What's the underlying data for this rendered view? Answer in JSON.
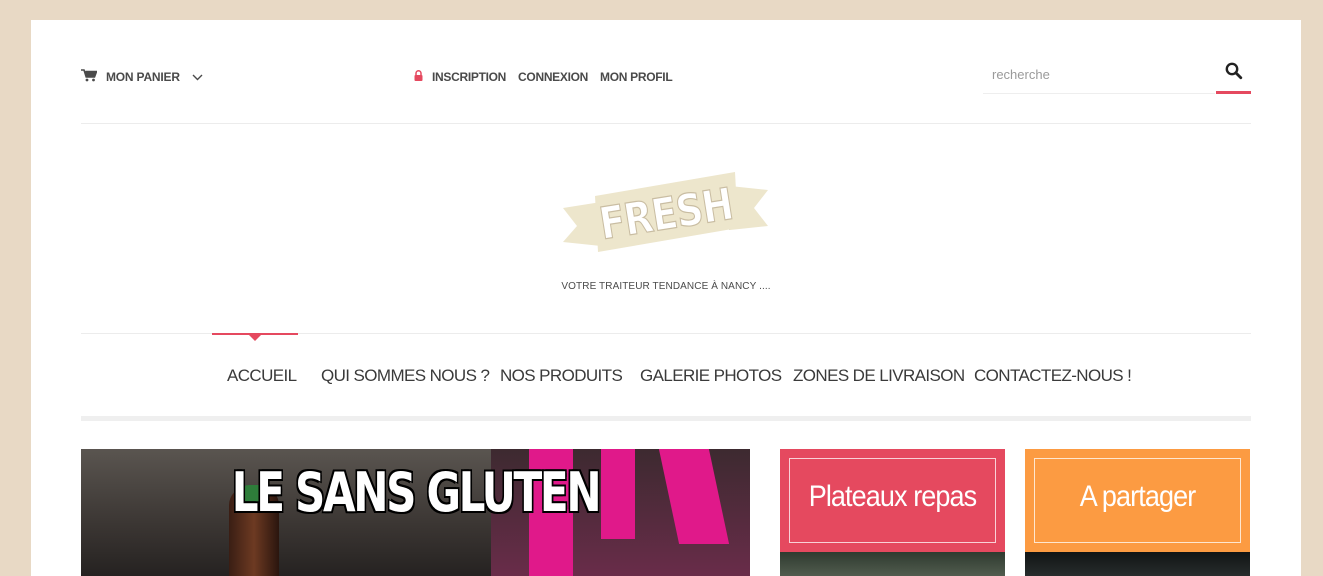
{
  "topbar": {
    "cart_label": "MON PANIER",
    "account_links": [
      "INSCRIPTION",
      "CONNEXION",
      "MON PROFIL"
    ],
    "search_placeholder": "recherche"
  },
  "branding": {
    "logo_text": "FRESH",
    "tagline": "VOTRE TRAITEUR TENDANCE À NANCY ....",
    "logo_color": "#ede6cc",
    "logo_shadow": "#c9bda2"
  },
  "nav": {
    "items": [
      "ACCUEIL",
      "QUI SOMMES NOUS ?",
      "NOS PRODUITS",
      "GALERIE PHOTOS",
      "ZONES DE LIVRAISON",
      "CONTACTEZ-NOUS !"
    ],
    "active_index": 0
  },
  "hero": {
    "title": "LE SANS GLUTEN"
  },
  "tiles": [
    {
      "label": "Plateaux repas",
      "color": "#e5495f"
    },
    {
      "label": "A partager",
      "color": "#fc9b42"
    }
  ],
  "colors": {
    "accent": "#e5495f",
    "background": "#e8d9c5",
    "text": "#4a4a4a"
  },
  "icons": {
    "cart": "cart-icon",
    "chevron": "chevron-down-icon",
    "lock": "lock-icon",
    "search": "search-icon"
  }
}
